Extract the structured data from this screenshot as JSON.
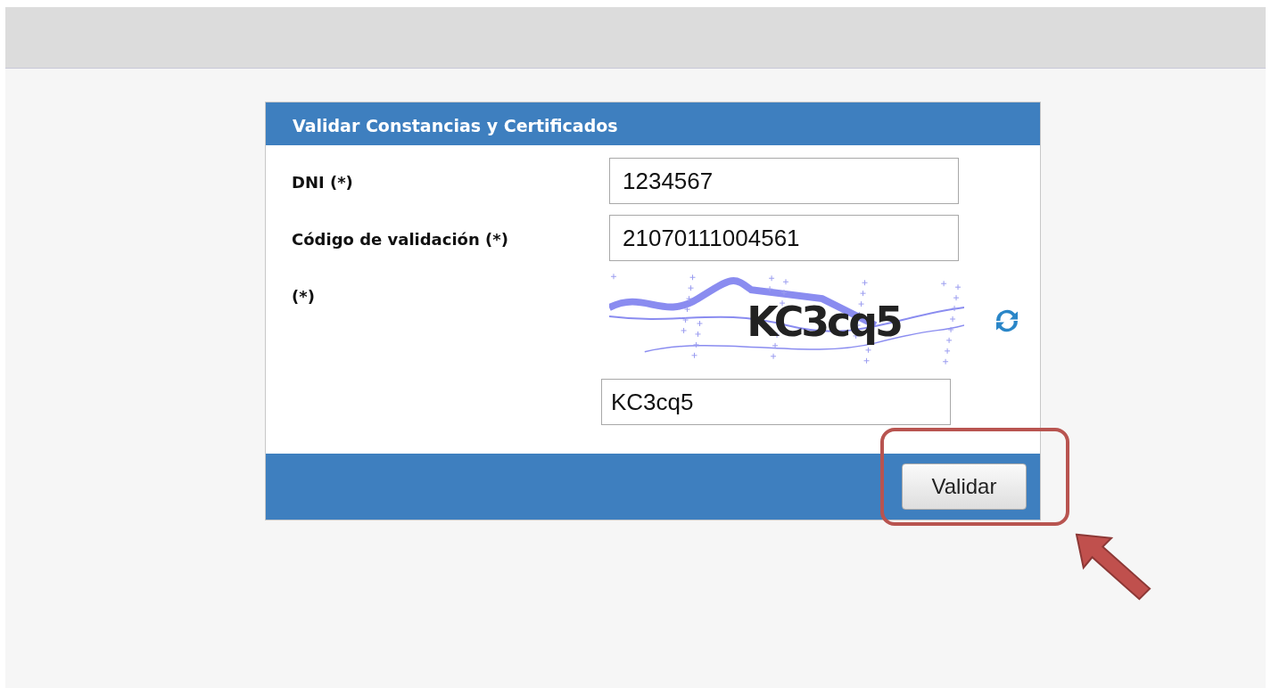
{
  "form": {
    "title": "Validar Constancias y Certificados",
    "fields": [
      {
        "kind": "input",
        "label": "DNI (*)",
        "value": "1234567"
      },
      {
        "kind": "input",
        "label": "Código de validación (*)",
        "value": "21070111004561"
      },
      {
        "kind": "captcha",
        "label": "(*)",
        "captcha_text": "KC3cq5",
        "value": "KC3cq5"
      }
    ],
    "submit": "Validar"
  },
  "annotation": {
    "highlight": true,
    "arrow": true
  }
}
